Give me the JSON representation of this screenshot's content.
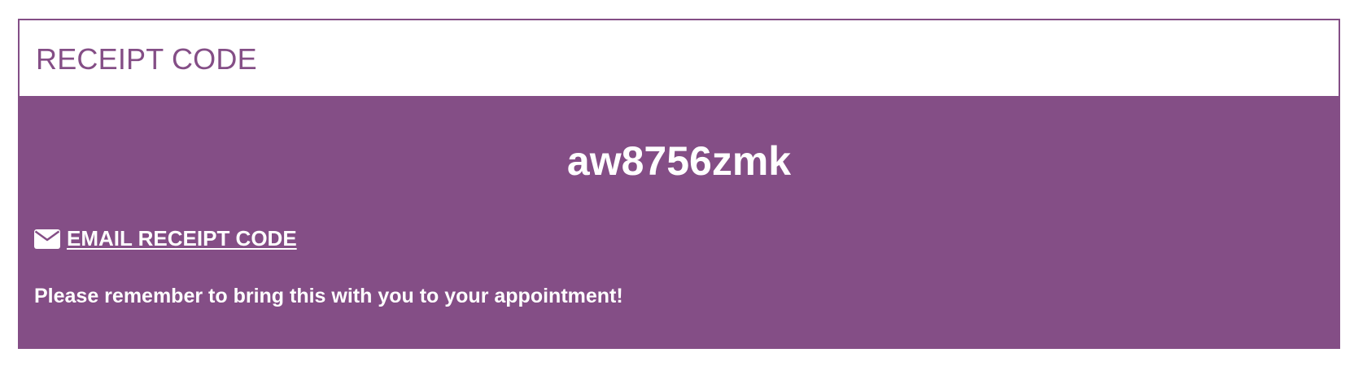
{
  "panel": {
    "title": "RECEIPT CODE",
    "receipt_code": "aw8756zmk",
    "email_link_label": "EMAIL RECEIPT CODE",
    "email_icon": "envelope-icon",
    "reminder_text": "Please remember to bring this with you to your appointment!"
  },
  "colors": {
    "accent": "#844e86",
    "text_on_accent": "#ffffff",
    "background": "#ffffff"
  }
}
